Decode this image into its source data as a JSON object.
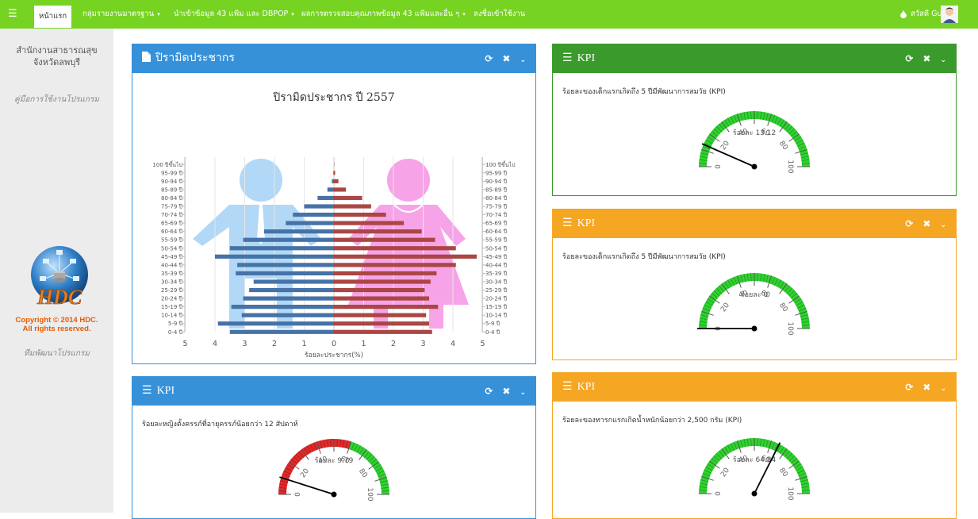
{
  "nav": {
    "menu_icon": "hamburger-icon",
    "items": [
      {
        "label": "หน้าแรก",
        "active": true
      },
      {
        "label": "กลุ่มรายงานมาตรฐาน",
        "dropdown": true
      },
      {
        "label": "นำเข้าข้อมูล 43 แฟ้ม และ DBPOP",
        "dropdown": true
      },
      {
        "label": "ผลการตรวจสอบคุณภาพข้อมูล 43 แฟ้มและอื่น ๆ",
        "dropdown": true
      },
      {
        "label": "ลงชื่อเข้าใช้งาน",
        "dropdown": false
      }
    ],
    "greeting": "สวัสดี Guest",
    "drop_icon": "water-drop-icon",
    "avatar_icon": "user-avatar-icon",
    "color": "#76d321"
  },
  "sidebar": {
    "org_name": "สำนักงานสาธารณสุขจังหวัดลพบุรี",
    "manual_link": "คู่มือการใช้งานโปรแกรม",
    "copyright_line1": "Copyright © 2014 HDC.",
    "copyright_line2": "All rights reserved.",
    "team_link": "ทีมพัฒนาโปรแกรม",
    "logo_text": "HDC"
  },
  "panels": {
    "population": {
      "title": "ปิรามิดประชากร",
      "icon": "document-icon",
      "color": "#3691d9"
    },
    "kpi1": {
      "title": "KPI",
      "label": "ร้อยละของเด็กแรกเกิดถึง 5 ปีมีพัฒนาการสมวัย (KPI)",
      "value_text": "ร้อยละ 13.12",
      "value": 13.12,
      "color": "#3a9a2b"
    },
    "kpi2": {
      "title": "KPI",
      "label": "ร้อยละของเด็กแรกเกิดถึง 5 ปีมีพัฒนาการสมวัย (KPI)",
      "value_text": "ร้อยละ 0",
      "value": 0,
      "color": "#f5a623"
    },
    "kpi3": {
      "title": "KPI",
      "label": "ร้อยละหญิงตั้งครรภ์ที่อายุครรภ์น้อยกว่า 12 สัปดาห์",
      "value_text": "ร้อยละ 9.79",
      "value": 9.79,
      "color": "#3691d9"
    },
    "kpi4": {
      "title": "KPI",
      "label": "ร้อยละของทารกแรกเกิดน้ำหนักน้อยกว่า 2,500 กรัม (KPI)",
      "value_text": "ร้อยละ 64.84",
      "value": 64.84,
      "color": "#f5a623"
    }
  },
  "tools": {
    "refresh_icon": "refresh-icon",
    "close_icon": "close-icon",
    "collapse_icon": "chevron-down-icon"
  },
  "gauge": {
    "ticks": [
      "0",
      "20",
      "40",
      "60",
      "80",
      "100"
    ]
  },
  "chart_data": {
    "type": "bar",
    "title": "ปิรามิดประชากร ปี 2557",
    "xlabel": "ร้อยละประชากร(%)",
    "xlim": [
      -5,
      5
    ],
    "x_ticks": [
      "5",
      "4",
      "3",
      "2",
      "1",
      "0",
      "1",
      "2",
      "3",
      "4",
      "5"
    ],
    "categories": [
      "100 ปีขึ้นไป",
      "95-99 ปี",
      "90-94 ปี",
      "85-89 ปี",
      "80-84 ปี",
      "75-79 ปี",
      "70-74 ปี",
      "65-69 ปี",
      "60-64 ปี",
      "55-59 ปี",
      "50-54 ปี",
      "45-49 ปี",
      "40-44 ปี",
      "35-39 ปี",
      "30-34 ปี",
      "25-29 ปี",
      "20-24 ปี",
      "15-19 ปี",
      "10-14 ปี",
      "5-9 ปี",
      "0-4 ปี"
    ],
    "series": [
      {
        "name": "ชาย",
        "color": "#4572a7",
        "values": [
          0.0,
          0.02,
          0.07,
          0.22,
          0.55,
          1.0,
          1.38,
          1.62,
          2.35,
          3.05,
          3.5,
          4.0,
          3.25,
          3.3,
          2.7,
          2.85,
          3.05,
          3.45,
          3.1,
          3.9,
          3.5
        ]
      },
      {
        "name": "หญิง",
        "color": "#aa4643",
        "values": [
          0.0,
          0.04,
          0.15,
          0.4,
          0.95,
          1.25,
          1.75,
          2.35,
          2.95,
          3.4,
          4.1,
          4.8,
          4.1,
          3.45,
          3.25,
          3.05,
          3.2,
          3.5,
          3.1,
          3.2,
          3.3
        ]
      }
    ]
  }
}
